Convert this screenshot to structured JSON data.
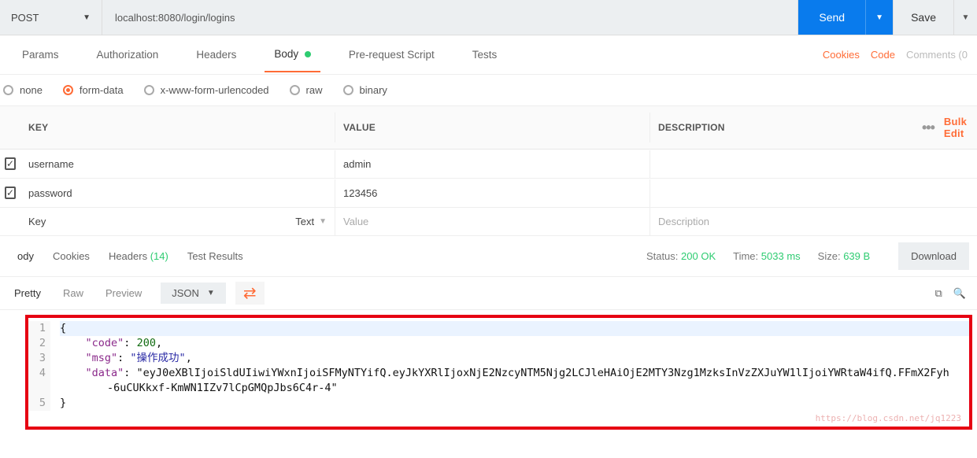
{
  "topbar": {
    "method": "POST",
    "url": "localhost:8080/login/logins",
    "send": "Send",
    "save": "Save"
  },
  "tabs": {
    "items": [
      "Params",
      "Authorization",
      "Headers",
      "Body",
      "Pre-request Script",
      "Tests"
    ],
    "active": "Body",
    "right": {
      "cookies": "Cookies",
      "code": "Code",
      "comments": "Comments (0"
    }
  },
  "body_radio": {
    "options": [
      "none",
      "form-data",
      "x-www-form-urlencoded",
      "raw",
      "binary"
    ],
    "selected": "form-data"
  },
  "kv": {
    "headers": {
      "key": "KEY",
      "value": "VALUE",
      "desc": "DESCRIPTION"
    },
    "bulk": "Bulk Edit",
    "rows": [
      {
        "checked": true,
        "key": "username",
        "value": "admin",
        "desc": ""
      },
      {
        "checked": true,
        "key": "password",
        "value": "123456",
        "desc": ""
      }
    ],
    "placeholder": {
      "key": "Key",
      "type": "Text",
      "value": "Value",
      "desc": "Description"
    }
  },
  "response": {
    "tabs": {
      "body": "ody",
      "cookies": "Cookies",
      "headers": "Headers",
      "headers_count": "(14)",
      "test": "Test Results"
    },
    "status_label": "Status:",
    "status_value": "200 OK",
    "time_label": "Time:",
    "time_value": "5033 ms",
    "size_label": "Size:",
    "size_value": "639 B",
    "download": "Download"
  },
  "view": {
    "tabs": [
      "Pretty",
      "Raw",
      "Preview"
    ],
    "active": "Pretty",
    "format": "JSON"
  },
  "json_body": {
    "lines": [
      "{",
      "    \"code\": 200,",
      "    \"msg\": \"操作成功\",",
      "    \"data\": \"eyJ0eXBlIjoiSldUIiwiYWxnIjoiSFMyNTYifQ.eyJkYXRlIjoxNjE2NzcyNTM5Njg2LCJleHAiOjE2MTY3Nzg1MzksInVzZXJuYW1lIjoiYWRtaW4ifQ.FFmX2Fyh-6uCUKkxf-KmWN1IZv7lCpGMQpJbs6C4r-4\"",
      "}"
    ]
  },
  "watermark": "https://blog.csdn.net/jq1223"
}
